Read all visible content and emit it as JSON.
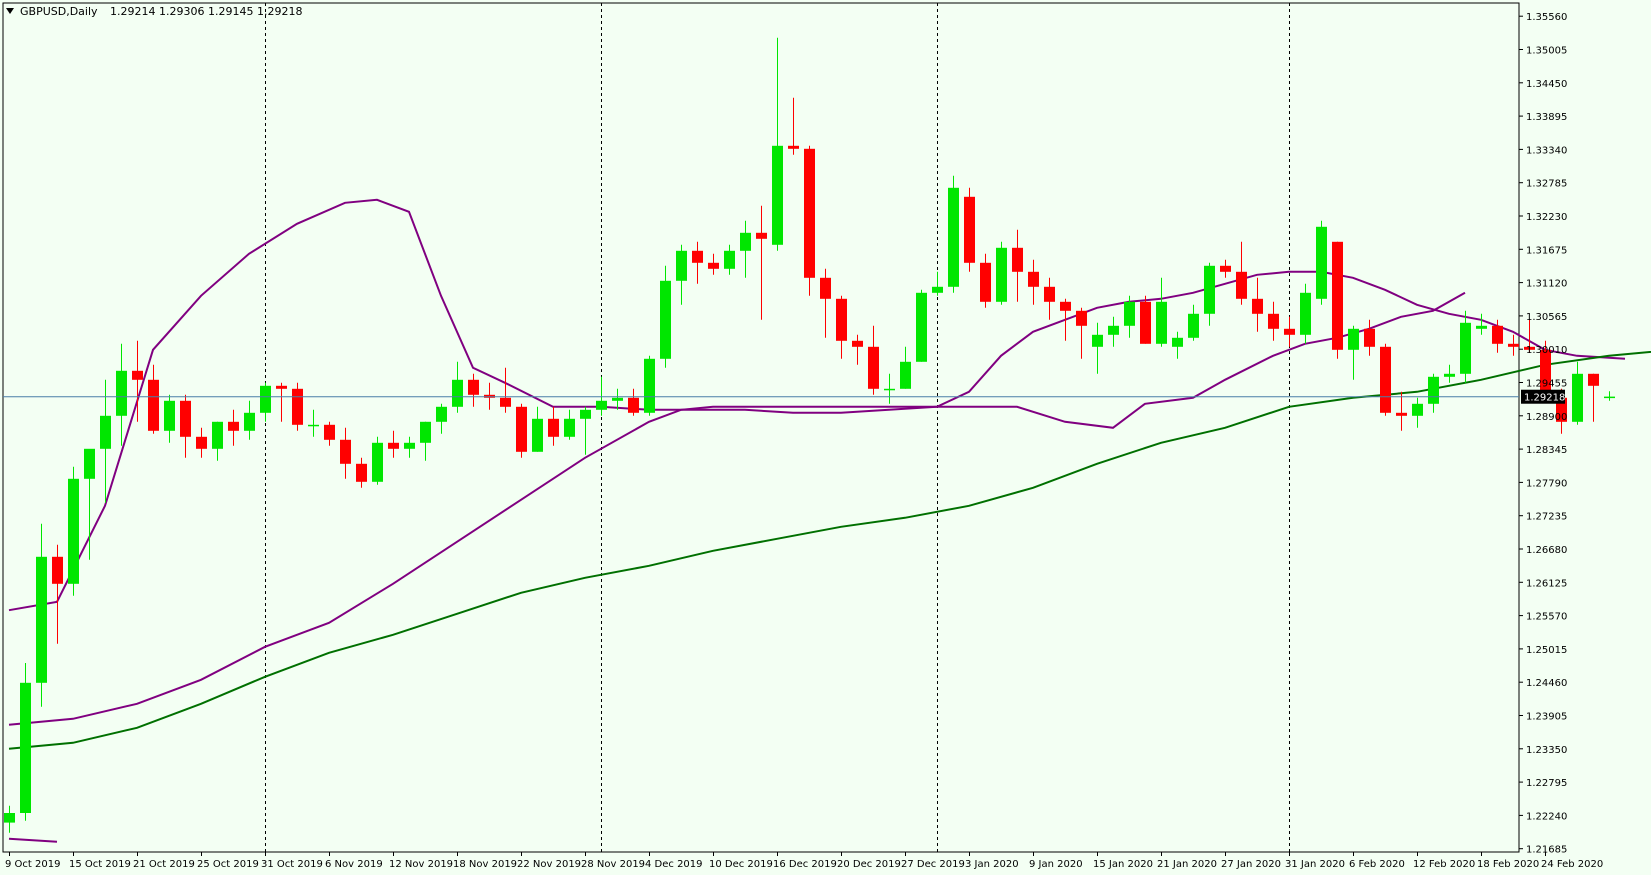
{
  "header": {
    "symbol": "GBPUSD,Daily",
    "ohlc": "1.29214 1.29306 1.29145 1.29218"
  },
  "colors": {
    "background": "#f3fff3",
    "bull_candle": "#00e600",
    "bear_candle": "#ff0000",
    "bollinger": "#800080",
    "moving_average": "#007000",
    "bid_line": "#4a7fa8",
    "frame": "#000000",
    "price_label_bg": "#000000",
    "price_label_text": "#ffffff"
  },
  "chart_data": {
    "type": "candlestick",
    "price_axis_ticks": [
      "1.35560",
      "1.35005",
      "1.34450",
      "1.33895",
      "1.33340",
      "1.32785",
      "1.32230",
      "1.31675",
      "1.31120",
      "1.30565",
      "1.30010",
      "1.29455",
      "1.28900",
      "1.28345",
      "1.27790",
      "1.27235",
      "1.26680",
      "1.26125",
      "1.25570",
      "1.25015",
      "1.24460",
      "1.23905",
      "1.23350",
      "1.22795",
      "1.22240",
      "1.21685"
    ],
    "ylim": [
      1.2163,
      1.3578
    ],
    "time_axis_labels": [
      "9 Oct 2019",
      "15 Oct 2019",
      "21 Oct 2019",
      "25 Oct 2019",
      "31 Oct 2019",
      "6 Nov 2019",
      "12 Nov 2019",
      "18 Nov 2019",
      "22 Nov 2019",
      "28 Nov 2019",
      "4 Dec 2019",
      "10 Dec 2019",
      "16 Dec 2019",
      "20 Dec 2019",
      "27 Dec 2019",
      "3 Jan 2020",
      "9 Jan 2020",
      "15 Jan 2020",
      "21 Jan 2020",
      "27 Jan 2020",
      "31 Jan 2020",
      "6 Feb 2020",
      "12 Feb 2020",
      "18 Feb 2020",
      "24 Feb 2020"
    ],
    "time_label_bar_index": [
      0,
      4,
      8,
      12,
      16,
      20,
      24,
      28,
      32,
      36,
      40,
      44,
      48,
      52,
      56,
      60,
      64,
      68,
      72,
      76,
      80,
      84,
      88,
      92,
      96
    ],
    "period_separator_bar_index": [
      16,
      37,
      58,
      80
    ],
    "current_price": "1.29218",
    "current_price_value": 1.29218,
    "candles": [
      [
        1.2212,
        1.224,
        1.2195,
        1.2228
      ],
      [
        1.2228,
        1.2478,
        1.2215,
        1.2445
      ],
      [
        1.2445,
        1.271,
        1.2405,
        1.2655
      ],
      [
        1.2655,
        1.2675,
        1.251,
        1.261
      ],
      [
        1.261,
        1.2805,
        1.259,
        1.2785
      ],
      [
        1.2785,
        1.283,
        1.265,
        1.2835
      ],
      [
        1.2835,
        1.295,
        1.2745,
        1.289
      ],
      [
        1.289,
        1.301,
        1.284,
        1.2965
      ],
      [
        1.2965,
        1.3015,
        1.288,
        1.295
      ],
      [
        1.295,
        1.2975,
        1.286,
        1.2865
      ],
      [
        1.2865,
        1.2925,
        1.2845,
        1.2915
      ],
      [
        1.2915,
        1.2925,
        1.282,
        1.2855
      ],
      [
        1.2855,
        1.287,
        1.282,
        1.2835
      ],
      [
        1.2835,
        1.288,
        1.2815,
        1.288
      ],
      [
        1.288,
        1.29,
        1.284,
        1.2865
      ],
      [
        1.2865,
        1.2915,
        1.285,
        1.2895
      ],
      [
        1.2895,
        1.2945,
        1.288,
        1.294
      ],
      [
        1.294,
        1.2945,
        1.288,
        1.2935
      ],
      [
        1.2935,
        1.2945,
        1.2865,
        1.2875
      ],
      [
        1.2875,
        1.29,
        1.2855,
        1.2875
      ],
      [
        1.2875,
        1.288,
        1.284,
        1.285
      ],
      [
        1.285,
        1.287,
        1.2785,
        1.281
      ],
      [
        1.281,
        1.282,
        1.277,
        1.278
      ],
      [
        1.278,
        1.2855,
        1.2775,
        1.2845
      ],
      [
        1.2845,
        1.2865,
        1.282,
        1.2835
      ],
      [
        1.2835,
        1.2855,
        1.282,
        1.2845
      ],
      [
        1.2845,
        1.288,
        1.2815,
        1.288
      ],
      [
        1.288,
        1.291,
        1.286,
        1.2905
      ],
      [
        1.2905,
        1.298,
        1.2895,
        1.295
      ],
      [
        1.295,
        1.296,
        1.2905,
        1.2925
      ],
      [
        1.2925,
        1.2945,
        1.29,
        1.292
      ],
      [
        1.292,
        1.297,
        1.2895,
        1.2905
      ],
      [
        1.2905,
        1.291,
        1.282,
        1.283
      ],
      [
        1.283,
        1.2905,
        1.283,
        1.2885
      ],
      [
        1.2885,
        1.2905,
        1.284,
        1.2855
      ],
      [
        1.2855,
        1.29,
        1.285,
        1.2885
      ],
      [
        1.2885,
        1.2905,
        1.2825,
        1.29
      ],
      [
        1.29,
        1.2955,
        1.289,
        1.2915
      ],
      [
        1.2915,
        1.2935,
        1.29,
        1.292
      ],
      [
        1.292,
        1.2935,
        1.289,
        1.2895
      ],
      [
        1.2895,
        1.299,
        1.289,
        1.2985
      ],
      [
        1.2985,
        1.314,
        1.297,
        1.3115
      ],
      [
        1.3115,
        1.3175,
        1.3075,
        1.3165
      ],
      [
        1.3165,
        1.318,
        1.311,
        1.3145
      ],
      [
        1.3145,
        1.316,
        1.3125,
        1.3135
      ],
      [
        1.3135,
        1.3175,
        1.3125,
        1.3165
      ],
      [
        1.3165,
        1.3215,
        1.312,
        1.3195
      ],
      [
        1.3195,
        1.324,
        1.305,
        1.3185
      ],
      [
        1.3175,
        1.352,
        1.3165,
        1.334
      ],
      [
        1.334,
        1.342,
        1.3325,
        1.3335
      ],
      [
        1.3335,
        1.334,
        1.309,
        1.312
      ],
      [
        1.312,
        1.3135,
        1.302,
        1.3085
      ],
      [
        1.3085,
        1.309,
        1.2985,
        1.3015
      ],
      [
        1.3015,
        1.3025,
        1.2975,
        1.3005
      ],
      [
        1.3005,
        1.304,
        1.2925,
        1.2935
      ],
      [
        1.2935,
        1.296,
        1.291,
        1.2935
      ],
      [
        1.2935,
        1.3005,
        1.2935,
        1.298
      ],
      [
        1.298,
        1.31,
        1.298,
        1.3095
      ],
      [
        1.3095,
        1.313,
        1.309,
        1.3105
      ],
      [
        1.3105,
        1.329,
        1.3095,
        1.327
      ],
      [
        1.3255,
        1.327,
        1.313,
        1.3145
      ],
      [
        1.3145,
        1.316,
        1.307,
        1.308
      ],
      [
        1.308,
        1.318,
        1.3075,
        1.317
      ],
      [
        1.317,
        1.32,
        1.308,
        1.313
      ],
      [
        1.313,
        1.315,
        1.3075,
        1.3105
      ],
      [
        1.3105,
        1.312,
        1.305,
        1.308
      ],
      [
        1.308,
        1.3085,
        1.3015,
        1.3065
      ],
      [
        1.3065,
        1.307,
        1.2985,
        1.304
      ],
      [
        1.3005,
        1.3045,
        1.296,
        1.3025
      ],
      [
        1.3025,
        1.3055,
        1.3005,
        1.304
      ],
      [
        1.304,
        1.309,
        1.302,
        1.308
      ],
      [
        1.308,
        1.309,
        1.301,
        1.301
      ],
      [
        1.301,
        1.312,
        1.3005,
        1.308
      ],
      [
        1.3005,
        1.303,
        1.2985,
        1.302
      ],
      [
        1.302,
        1.3075,
        1.3015,
        1.306
      ],
      [
        1.306,
        1.3145,
        1.304,
        1.314
      ],
      [
        1.314,
        1.315,
        1.312,
        1.313
      ],
      [
        1.313,
        1.318,
        1.3075,
        1.3085
      ],
      [
        1.3085,
        1.312,
        1.303,
        1.306
      ],
      [
        1.306,
        1.308,
        1.3015,
        1.3035
      ],
      [
        1.3035,
        1.3055,
        1.3005,
        1.3025
      ],
      [
        1.3025,
        1.311,
        1.301,
        1.3095
      ],
      [
        1.3085,
        1.3215,
        1.3075,
        1.3205
      ],
      [
        1.318,
        1.318,
        1.2985,
        1.3
      ],
      [
        1.3,
        1.304,
        1.295,
        1.3035
      ],
      [
        1.3035,
        1.305,
        1.299,
        1.3005
      ],
      [
        1.3005,
        1.301,
        1.289,
        1.2895
      ],
      [
        1.2895,
        1.293,
        1.2865,
        1.289
      ],
      [
        1.289,
        1.292,
        1.287,
        1.291
      ],
      [
        1.291,
        1.296,
        1.2895,
        1.2955
      ],
      [
        1.2955,
        1.2975,
        1.2945,
        1.296
      ],
      [
        1.296,
        1.3065,
        1.2945,
        1.3045
      ],
      [
        1.3035,
        1.306,
        1.3025,
        1.304
      ],
      [
        1.304,
        1.305,
        1.2995,
        1.301
      ],
      [
        1.301,
        1.3025,
        1.299,
        1.3005
      ],
      [
        1.3005,
        1.305,
        1.2995,
        1.3
      ],
      [
        1.3,
        1.3015,
        1.2915,
        1.292
      ],
      [
        1.292,
        1.2935,
        1.286,
        1.288
      ],
      [
        1.288,
        1.298,
        1.2875,
        1.296
      ],
      [
        1.296,
        1.296,
        1.288,
        1.294
      ],
      [
        1.2921,
        1.2931,
        1.2915,
        1.2922
      ]
    ],
    "series": [
      {
        "name": "",
        "style": "bollinger-upper",
        "points": [
          [
            0,
            1.2566
          ],
          [
            3,
            1.258
          ],
          [
            6,
            1.274
          ],
          [
            9,
            1.3
          ],
          [
            12,
            1.309
          ],
          [
            15,
            1.316
          ],
          [
            18,
            1.321
          ],
          [
            21,
            1.3245
          ],
          [
            23,
            1.325
          ],
          [
            25,
            1.323
          ],
          [
            27,
            1.309
          ],
          [
            29,
            1.297
          ],
          [
            31,
            1.2945
          ],
          [
            34,
            1.2905
          ],
          [
            37,
            1.2905
          ],
          [
            40,
            1.29
          ],
          [
            43,
            1.29
          ],
          [
            46,
            1.29
          ],
          [
            49,
            1.2895
          ],
          [
            52,
            1.2895
          ],
          [
            55,
            1.29
          ],
          [
            58,
            1.2905
          ],
          [
            61,
            1.2905
          ],
          [
            63,
            1.2905
          ],
          [
            66,
            1.288
          ],
          [
            69,
            1.287
          ],
          [
            71,
            1.291
          ],
          [
            74,
            1.292
          ],
          [
            76,
            1.295
          ],
          [
            79,
            1.299
          ],
          [
            81,
            1.301
          ],
          [
            83,
            1.302
          ],
          [
            85,
            1.3035
          ],
          [
            87,
            1.3055
          ],
          [
            89,
            1.3065
          ],
          [
            91,
            1.3095
          ]
        ]
      },
      {
        "name": "",
        "style": "bollinger-mid",
        "points": [
          [
            0,
            1.2375
          ],
          [
            4,
            1.2385
          ],
          [
            8,
            1.241
          ],
          [
            12,
            1.245
          ],
          [
            16,
            1.2505
          ],
          [
            20,
            1.2545
          ],
          [
            24,
            1.261
          ],
          [
            28,
            1.268
          ],
          [
            32,
            1.275
          ],
          [
            36,
            1.282
          ],
          [
            40,
            1.288
          ],
          [
            42,
            1.29
          ],
          [
            44,
            1.2905
          ],
          [
            46,
            1.2905
          ],
          [
            49,
            1.2905
          ],
          [
            52,
            1.2905
          ],
          [
            55,
            1.2905
          ],
          [
            58,
            1.2905
          ],
          [
            60,
            1.293
          ],
          [
            62,
            1.299
          ],
          [
            64,
            1.303
          ],
          [
            66,
            1.305
          ],
          [
            68,
            1.307
          ],
          [
            70,
            1.308
          ],
          [
            72,
            1.3085
          ],
          [
            74,
            1.3095
          ],
          [
            76,
            1.311
          ],
          [
            78,
            1.3125
          ],
          [
            80,
            1.313
          ],
          [
            82,
            1.313
          ],
          [
            84,
            1.312
          ],
          [
            86,
            1.31
          ],
          [
            88,
            1.3075
          ],
          [
            90,
            1.306
          ],
          [
            92,
            1.305
          ],
          [
            94,
            1.303
          ],
          [
            96,
            1.3
          ],
          [
            98,
            1.299
          ],
          [
            101,
            1.2985
          ]
        ]
      },
      {
        "name": "",
        "style": "moving-average",
        "points": [
          [
            0,
            1.2335
          ],
          [
            4,
            1.2345
          ],
          [
            8,
            1.237
          ],
          [
            12,
            1.241
          ],
          [
            16,
            1.2455
          ],
          [
            20,
            1.2495
          ],
          [
            24,
            1.2525
          ],
          [
            28,
            1.256
          ],
          [
            32,
            1.2595
          ],
          [
            36,
            1.262
          ],
          [
            40,
            1.264
          ],
          [
            44,
            1.2665
          ],
          [
            48,
            1.2685
          ],
          [
            52,
            1.2705
          ],
          [
            56,
            1.272
          ],
          [
            60,
            1.274
          ],
          [
            64,
            1.277
          ],
          [
            68,
            1.281
          ],
          [
            72,
            1.2845
          ],
          [
            76,
            1.287
          ],
          [
            80,
            1.2905
          ],
          [
            84,
            1.292
          ],
          [
            88,
            1.293
          ],
          [
            92,
            1.295
          ],
          [
            96,
            1.2975
          ],
          [
            100,
            1.299
          ],
          [
            104,
            1.3
          ],
          [
            108,
            1.301
          ],
          [
            112,
            1.3015
          ],
          [
            116,
            1.3015
          ]
        ]
      },
      {
        "name": "",
        "style": "bollinger-lower",
        "points": [
          [
            0,
            1.2185
          ],
          [
            3,
            1.218
          ]
        ]
      }
    ]
  }
}
